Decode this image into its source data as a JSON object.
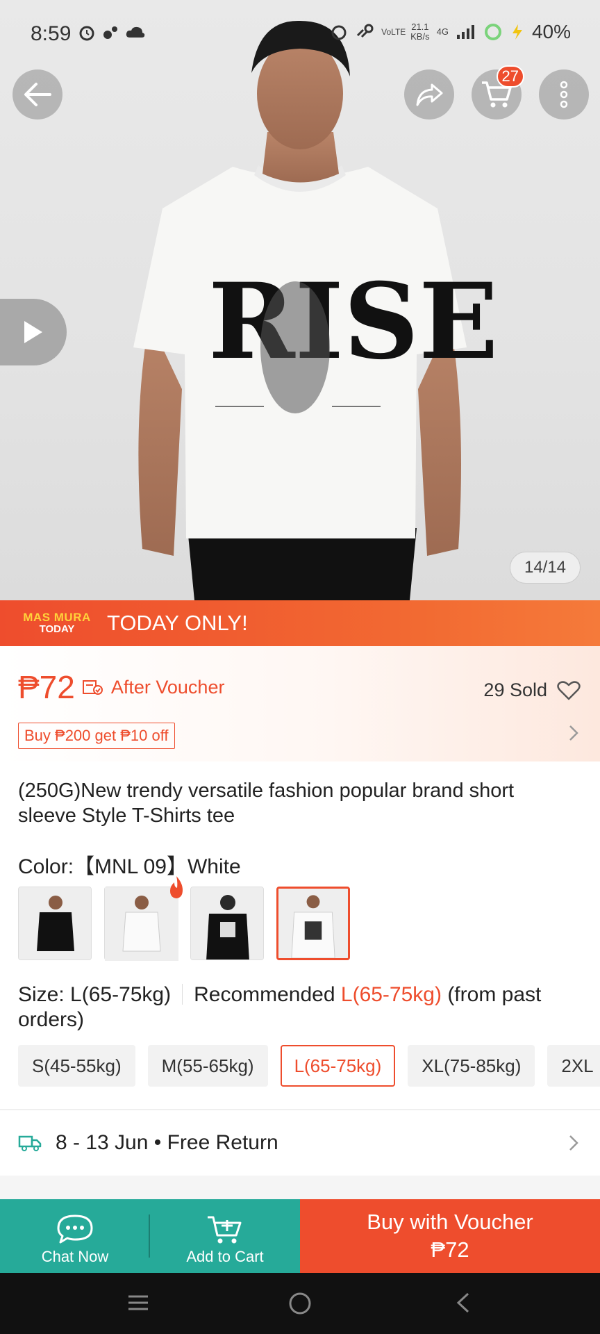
{
  "status_bar": {
    "time": "8:59",
    "net_speed_value": "21.1",
    "net_speed_unit": "KB/s",
    "volte": "VoLTE",
    "network": "4G",
    "battery": "40%"
  },
  "header": {
    "cart_count": "27"
  },
  "gallery": {
    "counter": "14/14",
    "shirt_print": "RISE"
  },
  "promo": {
    "logo_line1": "MAS MURA",
    "logo_line2": "TODAY",
    "text": "TODAY ONLY!"
  },
  "price": {
    "value": "₱72",
    "after_voucher": "After Voucher",
    "sold": "29 Sold",
    "deal_tag": "Buy ₱200 get ₱10 off"
  },
  "product": {
    "title": "(250G)New trendy versatile fashion popular brand short sleeve Style T-Shirts tee",
    "color_label": "Color:",
    "color_value": "【MNL 09】White"
  },
  "size": {
    "label": "Size: L(65-75kg)",
    "recommended_prefix": "Recommended",
    "recommended_size": "L(65-75kg)",
    "recommended_suffix": "(from past orders)",
    "options": [
      "S(45-55kg)",
      "M(55-65kg)",
      "L(65-75kg)",
      "XL(75-85kg)",
      "2XL"
    ],
    "selected_index": 2
  },
  "delivery": {
    "text": "8 - 13 Jun • Free Return"
  },
  "actions": {
    "chat": "Chat Now",
    "add_to_cart": "Add to Cart",
    "buy_line1": "Buy with Voucher",
    "buy_line2": "₱72"
  },
  "colors": {
    "accent": "#ee4d2d",
    "teal": "#26aa99"
  }
}
